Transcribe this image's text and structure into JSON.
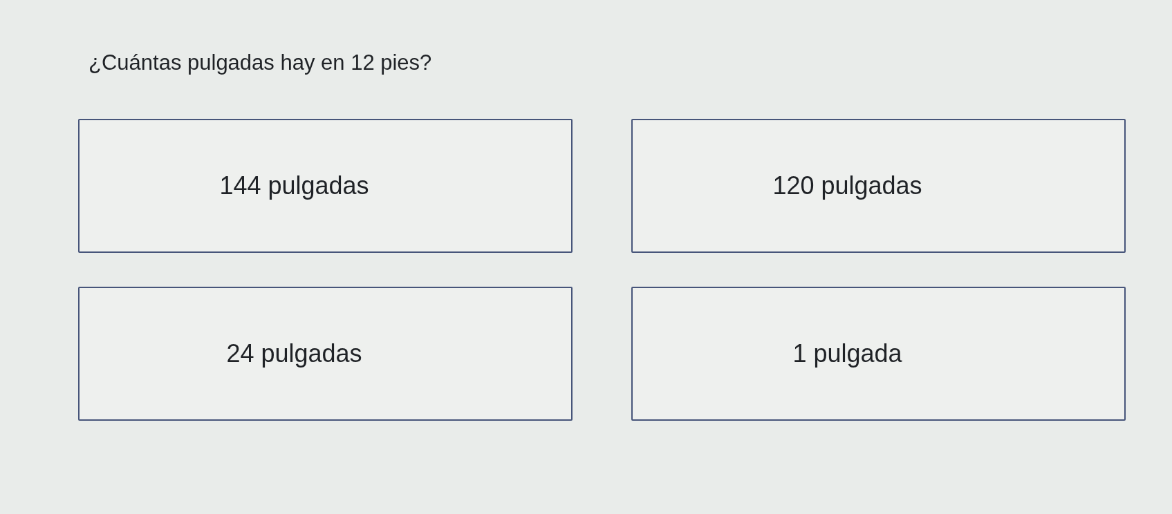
{
  "question": "¿Cuántas pulgadas hay en 12 pies?",
  "options": [
    {
      "label": "144 pulgadas"
    },
    {
      "label": "120 pulgadas"
    },
    {
      "label": "24 pulgadas"
    },
    {
      "label": "1 pulgada"
    }
  ]
}
